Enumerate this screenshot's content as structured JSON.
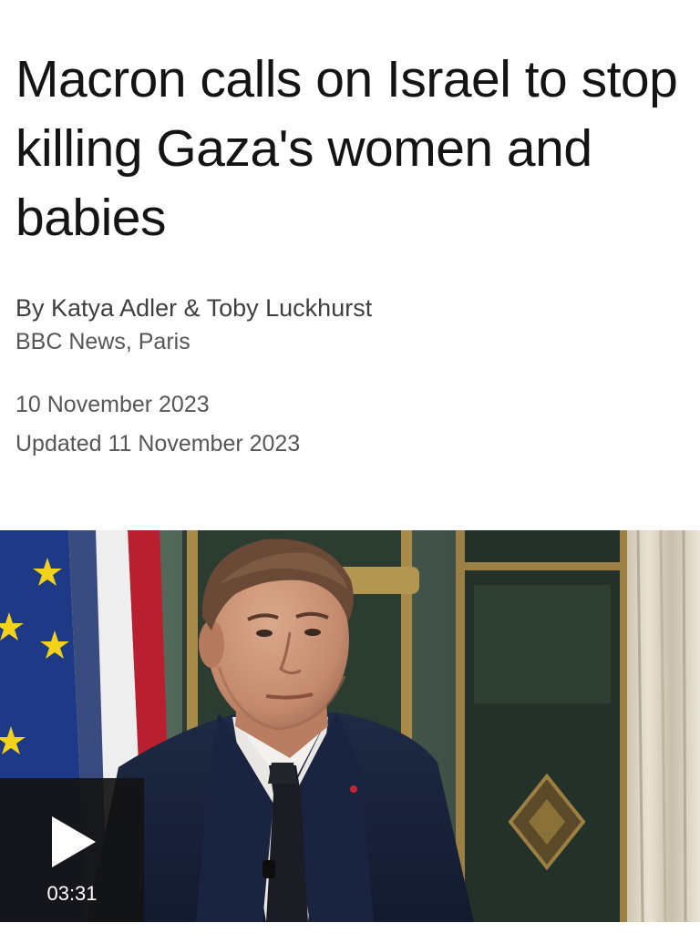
{
  "article": {
    "headline": "Macron calls on Israel to stop killing Gaza's women and babies",
    "byline": {
      "authors": "By Katya Adler & Toby Luckhurst",
      "organisation": "BBC News, Paris"
    },
    "published": "10 November 2023",
    "updated": "Updated 11 November 2023"
  },
  "video": {
    "duration": "03:31",
    "play_icon": "play-icon"
  }
}
